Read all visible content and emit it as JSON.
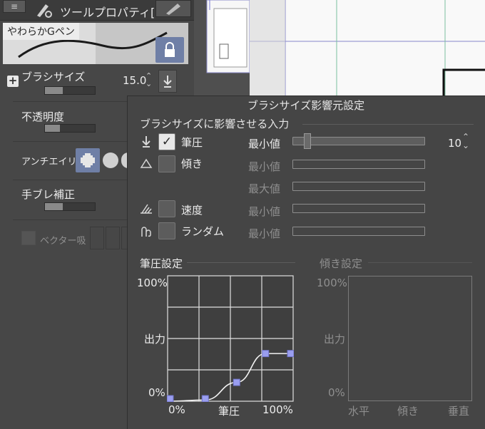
{
  "tool_panel": {
    "menu_glyph": "≡",
    "tab_icon": "tool-property-icon",
    "title": "ツールプロパティ[",
    "brush_name": "やわらかGペン",
    "lock_icon": "lock-icon",
    "brush_size": {
      "label": "ブラシサイズ",
      "value": "15.0",
      "expand_glyph": "+",
      "level": 0.35
    },
    "opacity": {
      "label": "不透明度",
      "level": 0.3
    },
    "antialias": {
      "label": "アンチエイリ"
    },
    "stabilization": {
      "label": "手ブレ補正",
      "level": 0.35
    },
    "vector": {
      "label": "ベクター吸"
    }
  },
  "dialog": {
    "title": "ブラシサイズ影響元設定",
    "section_title": "ブラシサイズに影響させる入力",
    "inputs": [
      {
        "icon": "pen-pressure-icon",
        "icon_glyph": "⤓",
        "label": "筆圧",
        "checked": true,
        "param": "最小値",
        "enabled": true,
        "value": "10",
        "slider_level": 0.06
      },
      {
        "icon": "tilt-icon",
        "icon_glyph": "△",
        "label": "傾き",
        "checked": false,
        "param": "最小値",
        "param2": "最大値",
        "enabled": false
      },
      {
        "icon": "speed-icon",
        "icon_glyph": "⊿",
        "label": "速度",
        "checked": false,
        "param": "最小値",
        "enabled": false
      },
      {
        "icon": "random-icon",
        "icon_glyph": "ʃ",
        "label": "ランダム",
        "checked": false,
        "param": "最小値",
        "enabled": false
      }
    ],
    "pressure_graph": {
      "title": "筆圧設定",
      "y_top": "100%",
      "y_mid": "出力",
      "y_bottom": "0%",
      "x_left": "0%",
      "x_mid": "筆圧",
      "x_right": "100%",
      "control_points": [
        [
          0,
          0
        ],
        [
          0.3,
          0.01
        ],
        [
          0.55,
          0.15
        ],
        [
          0.78,
          0.38
        ],
        [
          1.0,
          0.38
        ]
      ]
    },
    "tilt_graph": {
      "title": "傾き設定",
      "y_top": "100%",
      "y_mid": "出力",
      "y_bottom": "0%",
      "x_left": "水平",
      "x_mid": "傾き",
      "x_right": "垂直"
    }
  }
}
